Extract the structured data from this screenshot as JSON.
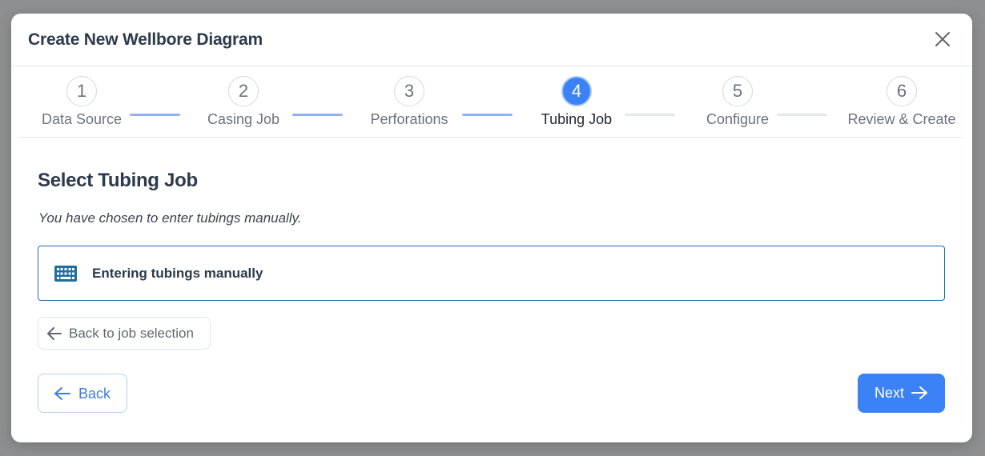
{
  "modal": {
    "title": "Create New Wellbore Diagram",
    "close_icon": "close-icon"
  },
  "stepper": {
    "steps": [
      {
        "number": "1",
        "label": "Data Source",
        "state": "completed"
      },
      {
        "number": "2",
        "label": "Casing Job",
        "state": "completed"
      },
      {
        "number": "3",
        "label": "Perforations",
        "state": "completed"
      },
      {
        "number": "4",
        "label": "Tubing Job",
        "state": "active"
      },
      {
        "number": "5",
        "label": "Configure",
        "state": "pending"
      },
      {
        "number": "6",
        "label": "Review & Create",
        "state": "pending"
      }
    ]
  },
  "content": {
    "title": "Select Tubing Job",
    "subtitle": "You have chosen to enter tubings manually.",
    "manual_card": {
      "icon": "keyboard-icon",
      "label": "Entering tubings manually"
    },
    "back_to_jobs": {
      "icon": "arrow-left-icon",
      "label": "Back to job selection"
    }
  },
  "footer": {
    "back": {
      "icon": "arrow-left-icon",
      "label": "Back"
    },
    "next": {
      "icon": "arrow-right-icon",
      "label": "Next"
    }
  },
  "colors": {
    "accent": "#3b82f6",
    "completed_connector": "#8fb4ec",
    "pending_connector": "#e4e6e9",
    "card_border": "#1f6f9c",
    "keyboard_icon": "#1f6f9c"
  }
}
